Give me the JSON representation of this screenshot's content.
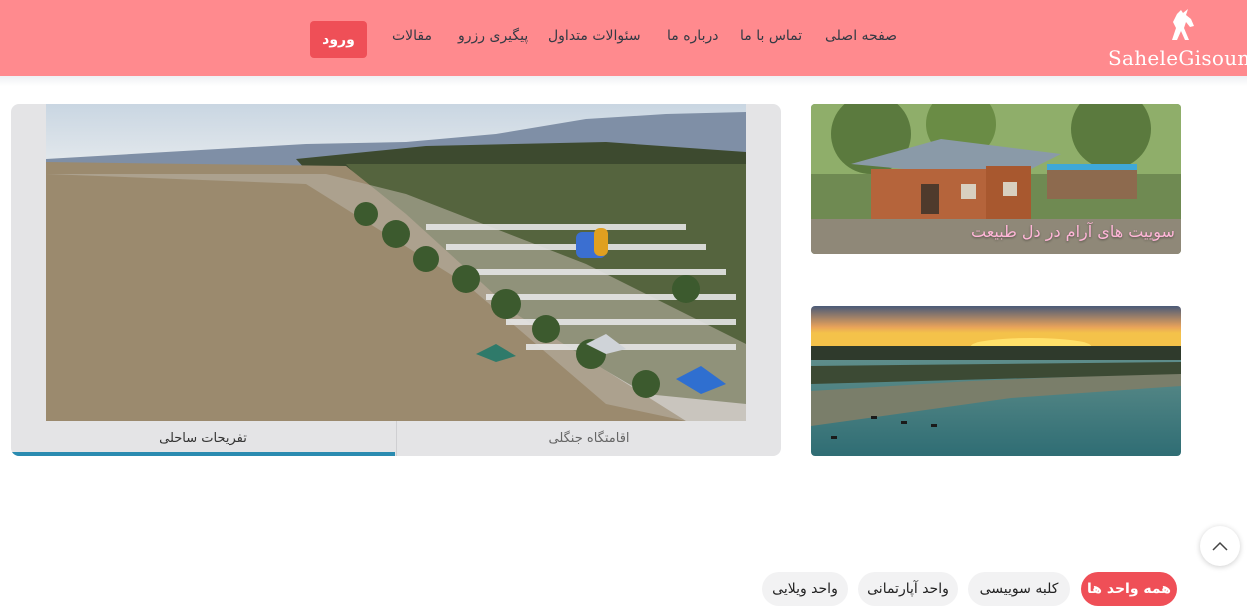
{
  "header": {
    "logo_text": "SaheleGisoum",
    "logo_icon": "horse-icon",
    "nav": {
      "home": "صفحه اصلی",
      "contact": "تماس با ما",
      "about": "درباره ما",
      "faq": "سئوالات متداول",
      "tracking": "پیگیری رزرو",
      "articles": "مقالات"
    },
    "login_label": "ورود"
  },
  "slider": {
    "tabs": [
      {
        "label": "تفریحات ساحلی",
        "active": true
      },
      {
        "label": "اقامتگاه جنگلی",
        "active": false
      }
    ],
    "progress_accent": "#2a8bb0"
  },
  "banners": [
    {
      "caption": "سوییت های آرام در دل طبیعت"
    },
    {
      "caption": ""
    }
  ],
  "filters": {
    "chips": [
      {
        "label": "همه واحد ها",
        "active": true
      },
      {
        "label": "کلبه سوییسی",
        "active": false
      },
      {
        "label": "واحد آپارتمانی",
        "active": false
      },
      {
        "label": "واحد ویلایی",
        "active": false
      }
    ]
  },
  "colors": {
    "header_bg": "#ff8a8e",
    "accent_red": "#ef4f57",
    "tab_progress": "#2a8bb0"
  },
  "icons": {
    "scroll_top": "chevron-up-icon"
  }
}
